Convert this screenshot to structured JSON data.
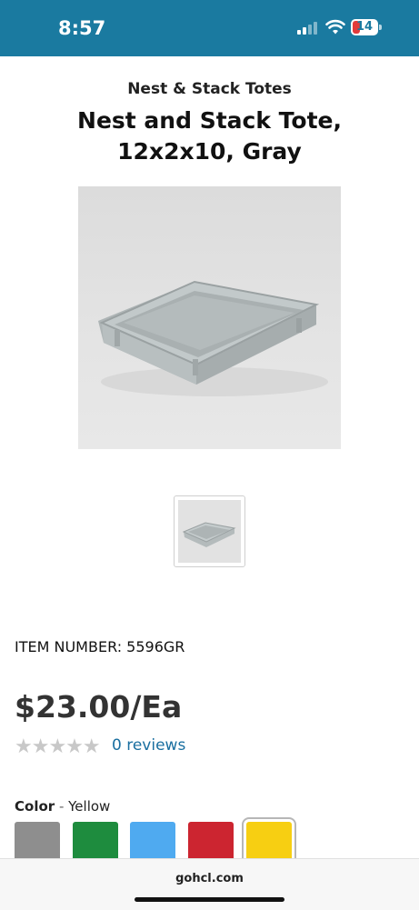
{
  "status": {
    "time": "8:57",
    "battery": "14"
  },
  "product": {
    "category": "Nest & Stack Totes",
    "title": "Nest and Stack Tote, 12x2x10, Gray",
    "item_number": "ITEM NUMBER: 5596GR",
    "price": "$23.00/Ea",
    "stars": "★★★★★",
    "reviews": "0 reviews",
    "color_label": "Color",
    "color_sep": " - ",
    "color_value": "Yellow",
    "swatches": [
      {
        "name": "Gray",
        "hex": "#8e8e8e"
      },
      {
        "name": "Green",
        "hex": "#1e8c3e"
      },
      {
        "name": "Blue",
        "hex": "#4faaf0"
      },
      {
        "name": "Red",
        "hex": "#cc2530"
      },
      {
        "name": "Yellow",
        "hex": "#f7cf12",
        "selected": true
      }
    ]
  },
  "browser": {
    "url": "gohcl.com"
  },
  "colors": {
    "status_bar": "#1a7aa0",
    "link": "#1a6fa0"
  }
}
